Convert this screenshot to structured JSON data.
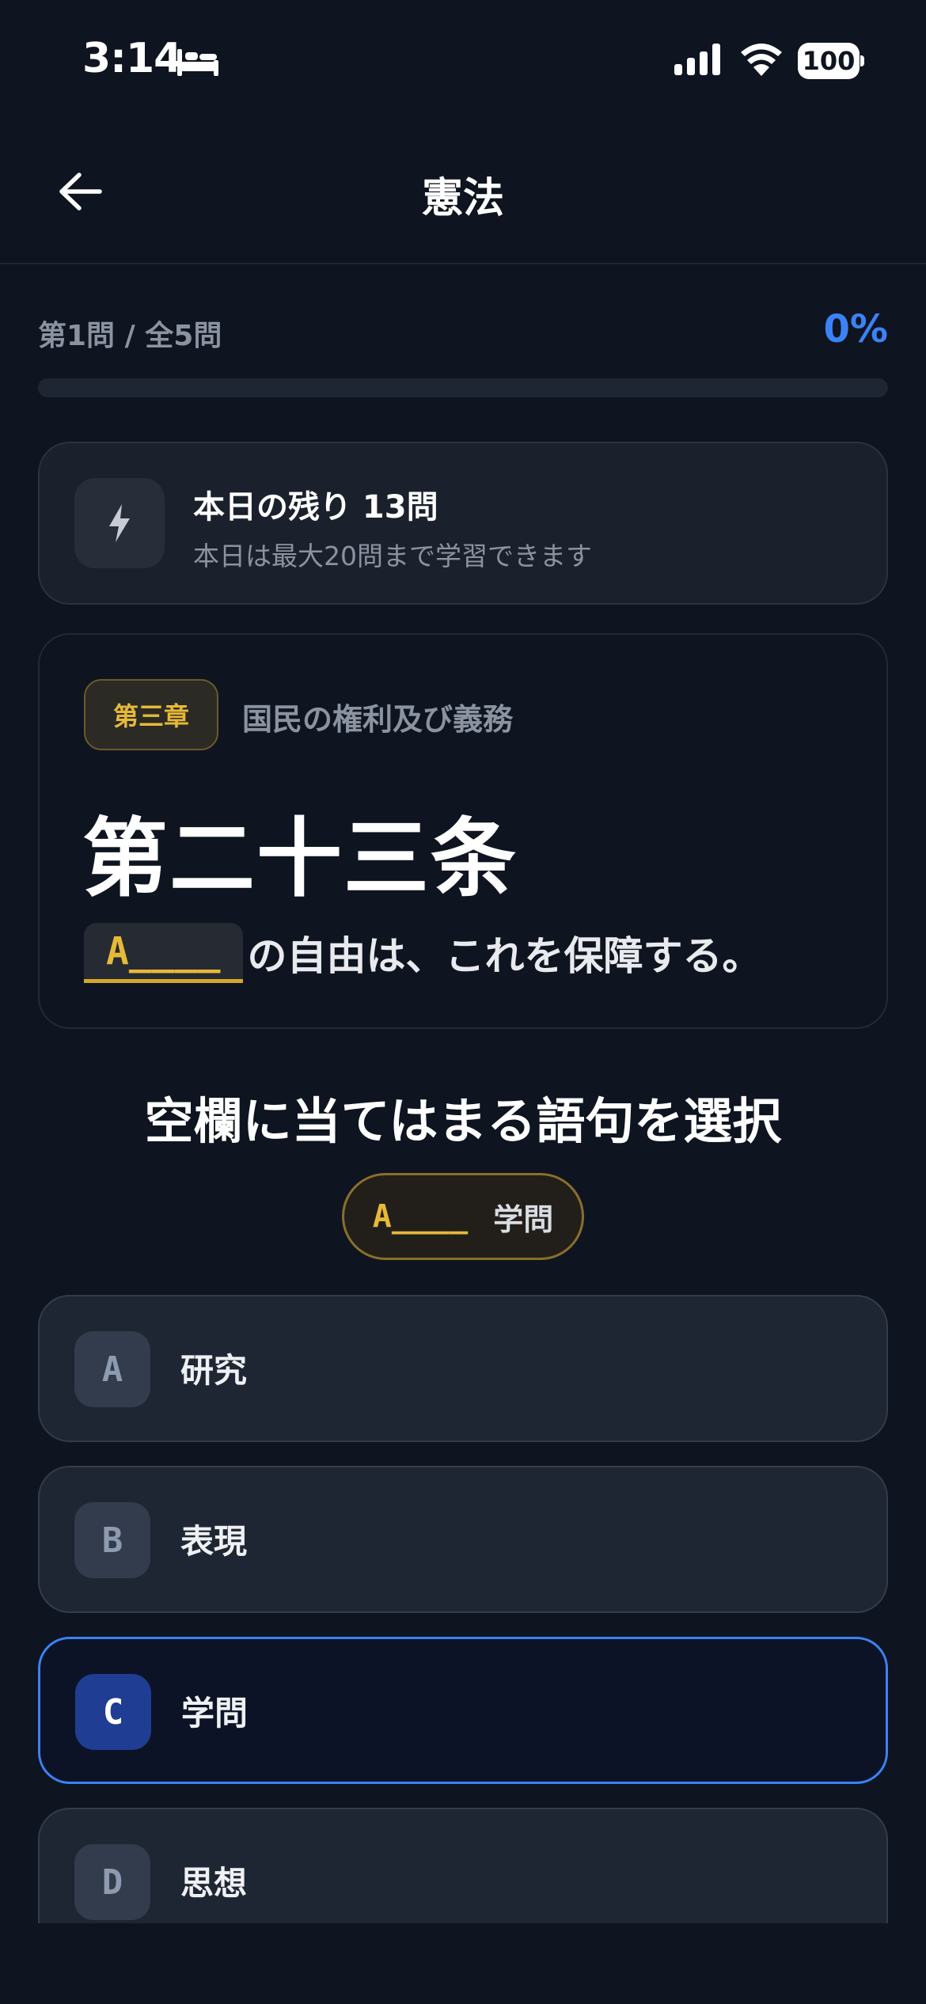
{
  "status_bar": {
    "time": "3:14",
    "battery": "100",
    "icons": [
      "bed-icon",
      "signal-icon",
      "wifi-icon",
      "battery-icon"
    ]
  },
  "nav": {
    "title": "憲法",
    "back_icon": "arrow-left-icon"
  },
  "progress": {
    "label": "第1問 / 全5問",
    "percent_text": "0%",
    "value": 0
  },
  "daily": {
    "icon": "lightning-icon",
    "title": "本日の残り 13問",
    "subtitle": "本日は最大20問まで学習できます"
  },
  "question": {
    "chapter_badge": "第三章",
    "chapter_title": "国民の権利及び義務",
    "article": "第二十三条",
    "blank": "A____",
    "sentence_rest": "の自由は、これを保障する。"
  },
  "instruction": "空欄に当てはまる語句を選択",
  "answer_pill": {
    "blank": "A____",
    "answer": "学問"
  },
  "options": [
    {
      "letter": "A",
      "text": "研究",
      "selected": false
    },
    {
      "letter": "B",
      "text": "表現",
      "selected": false
    },
    {
      "letter": "C",
      "text": "学問",
      "selected": true
    },
    {
      "letter": "D",
      "text": "思想",
      "selected": false
    }
  ],
  "colors": {
    "background": "#0e1420",
    "accent": "#3b82f6",
    "gold": "#e6b938"
  }
}
